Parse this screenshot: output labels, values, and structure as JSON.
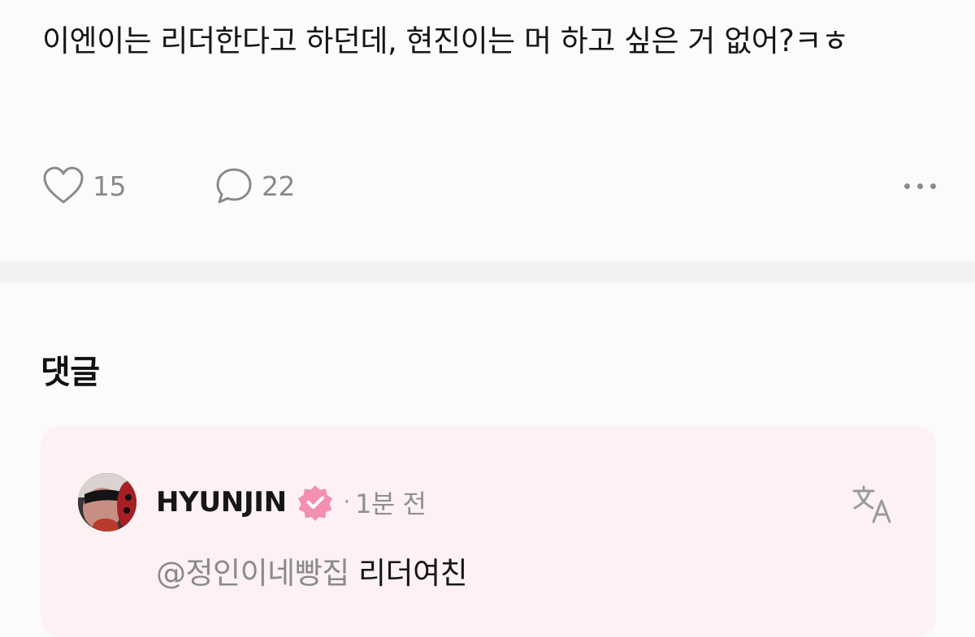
{
  "post": {
    "text": "이엔이는 리더한다고 하던데, 현진이는 머 하고 싶은 거 없어?ㅋㅎ",
    "likes": "15",
    "comments": "22"
  },
  "comments_section": {
    "title": "댓글"
  },
  "comment": {
    "author": "HYUNJIN",
    "meta_separator": "·",
    "timestamp": "1분 전",
    "mention": "@정인이네빵집",
    "text": "리더여친"
  },
  "icons": {
    "like": "heart-outline-icon",
    "comment": "speech-bubble-icon",
    "more": "more-dots-icon",
    "verified": "verified-badge-icon",
    "translate": "translate-icon"
  },
  "colors": {
    "background": "#fcfbfc",
    "comment_card": "#fdf1f3",
    "verified_badge": "#f28fb3",
    "muted_text": "#8a8a8a"
  }
}
